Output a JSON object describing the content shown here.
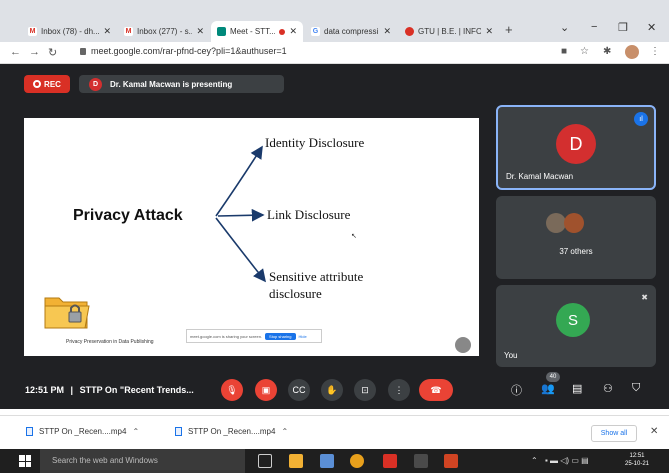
{
  "browser": {
    "tabs": [
      {
        "title": "Inbox (78) - dh...",
        "icon": "gmail-icon",
        "active": false
      },
      {
        "title": "Inbox (277) - s...",
        "icon": "gmail-icon",
        "active": false
      },
      {
        "title": "Meet - STT...",
        "icon": "meet-icon",
        "active": true,
        "recording": true
      },
      {
        "title": "data compressi...",
        "icon": "google-icon",
        "active": false
      },
      {
        "title": "GTU | B.E. | INFO...",
        "icon": "gtu-icon",
        "active": false
      }
    ],
    "url": "meet.google.com/rar-pfnd-cey?pli=1&authuser=1"
  },
  "meet": {
    "rec_label": "REC",
    "presenter_initial": "D",
    "presenting_text": "Dr. Kamal Macwan is presenting",
    "slide": {
      "center": "Privacy Attack",
      "branches": [
        "Identity Disclosure",
        "Link Disclosure",
        "Sensitive attribute",
        "disclosure"
      ],
      "caption": "Privacy Preservation in Data Publishing",
      "share_notice": "meet.google.com is sharing your screen.",
      "stop_sharing": "Stop sharing",
      "hide": "Hide"
    },
    "tiles": [
      {
        "initial": "D",
        "name": "Dr. Kamal Macwan",
        "color": "#d32f2f"
      },
      {
        "label": "37 others"
      },
      {
        "initial": "S",
        "name": "You",
        "color": "#34a853"
      }
    ],
    "time": "12:51 PM",
    "meeting_title": "STTP On \"Recent Trends...",
    "participants_count": "40"
  },
  "downloads": {
    "items": [
      "STTP On _Recen....mp4",
      "STTP On _Recen....mp4"
    ],
    "show_all": "Show all"
  },
  "taskbar": {
    "search_placeholder": "Search the web and Windows",
    "clock_time": "12:51",
    "clock_date": "25-10-21"
  }
}
